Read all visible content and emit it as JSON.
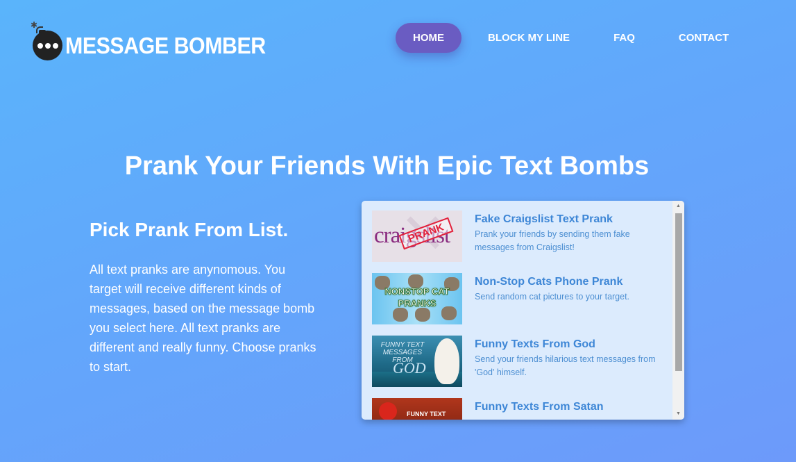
{
  "logo": {
    "text": "MESSAGE BOMBER",
    "icon": "bomb-icon"
  },
  "nav": {
    "items": [
      {
        "label": "HOME",
        "active": true
      },
      {
        "label": "BLOCK MY LINE",
        "active": false
      },
      {
        "label": "FAQ",
        "active": false
      },
      {
        "label": "CONTACT",
        "active": false
      }
    ],
    "active_color": "#6a5cc2"
  },
  "hero": {
    "headline": "Prank Your Friends With Epic Text Bombs"
  },
  "intro": {
    "heading": "Pick Prank From List.",
    "body": "All text pranks are anynomous. You target will receive different kinds of messages, based on the message bomb you select here. All text pranks are different and really funny. Choose pranks to start."
  },
  "pranks": [
    {
      "title": "Fake Craigslist Text Prank",
      "description": "Prank your friends by sending them fake messages from Craigslist!",
      "thumb_text": "craigslist",
      "thumb_stamp": "PRANK"
    },
    {
      "title": "Non-Stop Cats Phone Prank",
      "description": "Send random cat pictures to your target.",
      "thumb_text": "NONSTOP CAT PRANKS"
    },
    {
      "title": "Funny Texts From God",
      "description": "Send your friends hilarious text messages from 'God' himself.",
      "thumb_text": "FUNNY TEXT MESSAGES FROM",
      "thumb_word": "GOD"
    },
    {
      "title": "Funny Texts From Satan",
      "description": "",
      "thumb_text": "FUNNY TEXT"
    }
  ],
  "colors": {
    "background_top": "#5ab4fb",
    "background_bottom": "#6d9afa",
    "panel": "#dcebfd",
    "item_title": "#3d86d6"
  }
}
